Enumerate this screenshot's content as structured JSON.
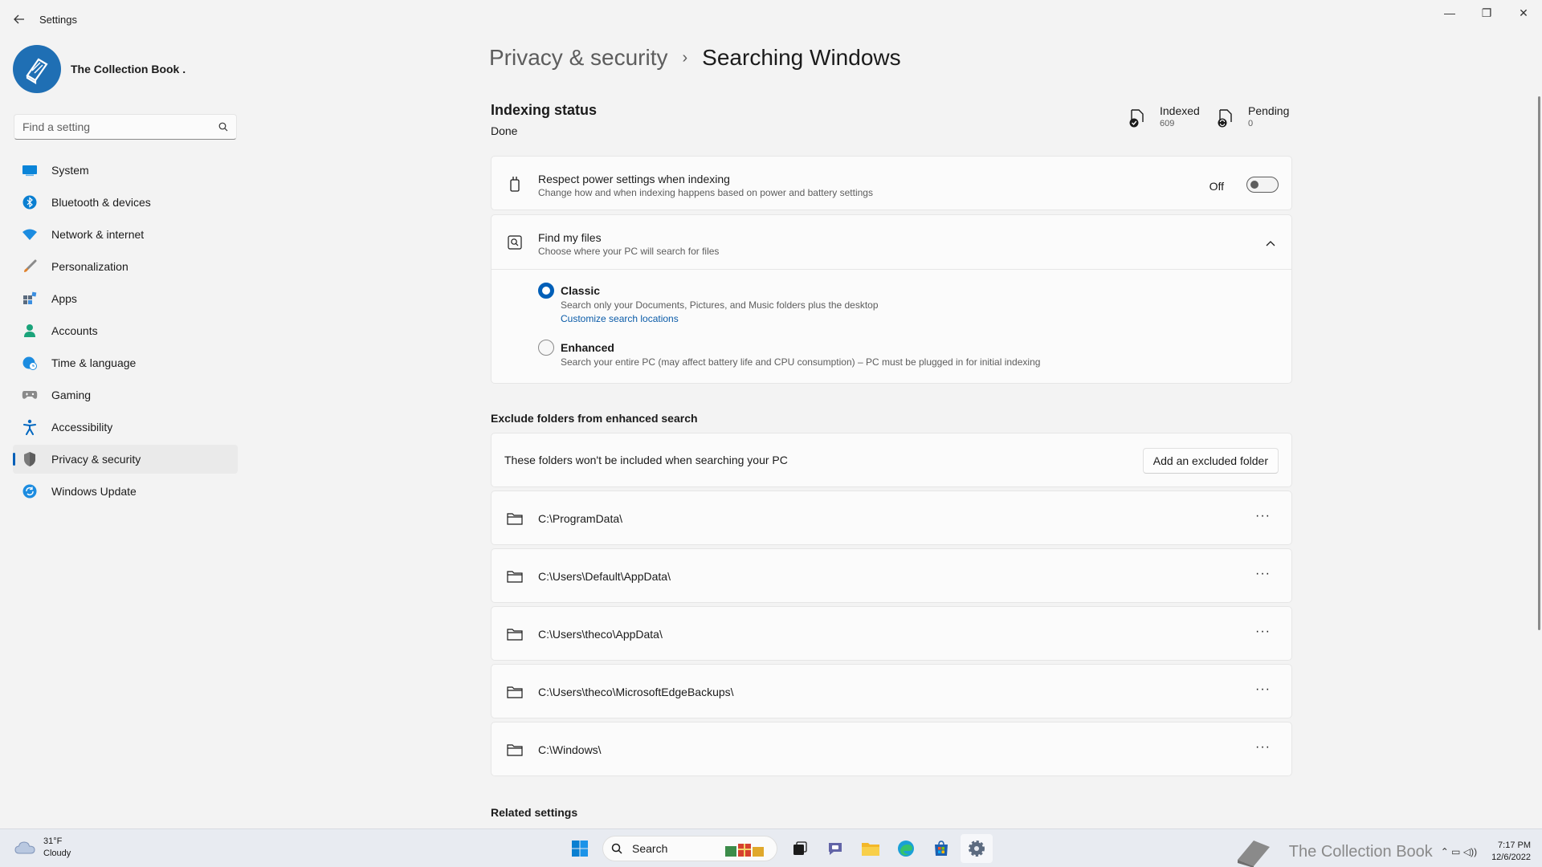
{
  "app": {
    "title": "Settings"
  },
  "window_controls": {
    "minimize": "—",
    "maximize": "❐",
    "close": "✕"
  },
  "profile": {
    "name": "The Collection Book ."
  },
  "search": {
    "placeholder": "Find a setting"
  },
  "sidebar": {
    "items": [
      {
        "label": "System",
        "icon": "system-icon",
        "color": "#0078d4"
      },
      {
        "label": "Bluetooth & devices",
        "icon": "bluetooth-icon",
        "color": "#0078d4"
      },
      {
        "label": "Network & internet",
        "icon": "wifi-icon",
        "color": "#0078d4"
      },
      {
        "label": "Personalization",
        "icon": "brush-icon",
        "color": "#e0812b"
      },
      {
        "label": "Apps",
        "icon": "apps-icon",
        "color": "#5b6b7e"
      },
      {
        "label": "Accounts",
        "icon": "person-icon",
        "color": "#1aa37a"
      },
      {
        "label": "Time & language",
        "icon": "globe-clock-icon",
        "color": "#0078d4"
      },
      {
        "label": "Gaming",
        "icon": "controller-icon",
        "color": "#7a7a7a"
      },
      {
        "label": "Accessibility",
        "icon": "accessibility-icon",
        "color": "#0067c0"
      },
      {
        "label": "Privacy & security",
        "icon": "shield-icon",
        "color": "#6b6b6b",
        "active": true
      },
      {
        "label": "Windows Update",
        "icon": "update-icon",
        "color": "#0078d4"
      }
    ]
  },
  "breadcrumb": {
    "parent": "Privacy & security",
    "separator": "›",
    "current": "Searching Windows"
  },
  "indexing": {
    "title": "Indexing status",
    "status": "Done",
    "indexed_label": "Indexed",
    "indexed_value": "609",
    "pending_label": "Pending",
    "pending_value": "0"
  },
  "power": {
    "title": "Respect power settings when indexing",
    "subtitle": "Change how and when indexing happens based on power and battery settings",
    "toggle_label": "Off",
    "toggle_on": false
  },
  "find_files": {
    "title": "Find my files",
    "subtitle": "Choose where your PC will search for files",
    "classic": {
      "label": "Classic",
      "desc": "Search only your Documents, Pictures, and Music folders plus the desktop",
      "link": "Customize search locations",
      "checked": true
    },
    "enhanced": {
      "label": "Enhanced",
      "desc": "Search your entire PC (may affect battery life and CPU consumption) – PC must be plugged in for initial indexing",
      "checked": false
    }
  },
  "exclude": {
    "section_title": "Exclude folders from enhanced search",
    "description": "These folders won't be included when searching your PC",
    "add_button": "Add an excluded folder",
    "more_label": "···",
    "folders": [
      "C:\\ProgramData\\",
      "C:\\Users\\Default\\AppData\\",
      "C:\\Users\\theco\\AppData\\",
      "C:\\Users\\theco\\MicrosoftEdgeBackups\\",
      "C:\\Windows\\"
    ]
  },
  "related": {
    "title": "Related settings"
  },
  "taskbar": {
    "weather_temp": "31°F",
    "weather_desc": "Cloudy",
    "search_label": "Search",
    "watermark": "The Collection Book",
    "time": "7:17 PM",
    "date": "12/6/2022",
    "tray": "⌃ ▭ ◁))",
    "accent": "#0067c0"
  }
}
